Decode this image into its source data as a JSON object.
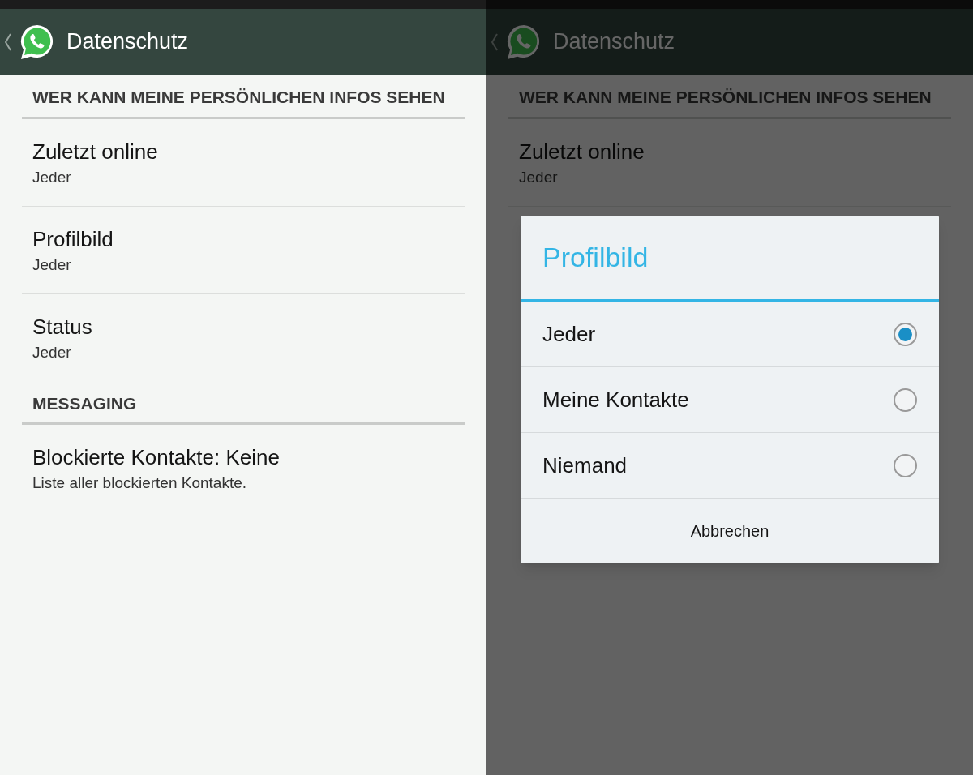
{
  "screens": [
    {
      "app_bar": {
        "title": "Datenschutz"
      },
      "dimmed": false,
      "sections": [
        {
          "header": "WER KANN MEINE PERSÖNLICHEN INFOS SEHEN",
          "items": [
            {
              "title": "Zuletzt online",
              "subtitle": "Jeder"
            },
            {
              "title": "Profilbild",
              "subtitle": "Jeder"
            },
            {
              "title": "Status",
              "subtitle": "Jeder"
            }
          ]
        },
        {
          "header": "MESSAGING",
          "items": [
            {
              "title": "Blockierte Kontakte: Keine",
              "subtitle": "Liste aller blockierten Kontakte."
            }
          ]
        }
      ]
    },
    {
      "app_bar": {
        "title": "Datenschutz"
      },
      "dimmed": true,
      "sections": [
        {
          "header": "WER KANN MEINE PERSÖNLICHEN INFOS SEHEN",
          "items": [
            {
              "title": "Zuletzt online",
              "subtitle": "Jeder"
            }
          ]
        }
      ],
      "dialog": {
        "title": "Profilbild",
        "options": [
          {
            "label": "Jeder",
            "selected": true
          },
          {
            "label": "Meine Kontakte",
            "selected": false
          },
          {
            "label": "Niemand",
            "selected": false
          }
        ],
        "cancel": "Abbrechen"
      }
    }
  ]
}
